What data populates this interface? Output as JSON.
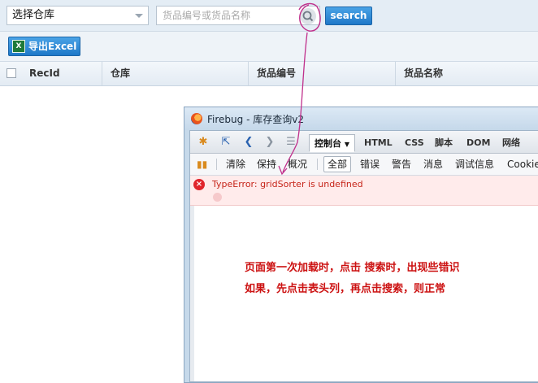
{
  "filters": {
    "warehouse_select_value": "选择仓库",
    "search_placeholder": "货品编号或货品名称",
    "search_button_label": "search"
  },
  "toolbar": {
    "export_button_label": "导出Excel",
    "export_icon": "excel-icon"
  },
  "grid": {
    "columns": [
      "RecId",
      "仓库",
      "货品编号",
      "货品名称"
    ]
  },
  "firebug": {
    "window_title": "Firebug - 库存查询v2",
    "tabs": [
      {
        "label": "控制台",
        "active": true
      },
      {
        "label": "HTML"
      },
      {
        "label": "CSS"
      },
      {
        "label": "脚本"
      },
      {
        "label": "DOM"
      },
      {
        "label": "网络"
      }
    ],
    "console_actions": [
      "清除",
      "保持",
      "概况"
    ],
    "filter_buttons": [
      {
        "label": "全部",
        "selected": true
      },
      {
        "label": "错误"
      },
      {
        "label": "警告"
      },
      {
        "label": "消息"
      },
      {
        "label": "调试信息"
      },
      {
        "label": "Cookie"
      }
    ],
    "error_message": "TypeError: gridSorter is undefined"
  },
  "annotation": {
    "line1": "页面第一次加载时，点击 搜索时，出现些错识",
    "line2": "如果，先点击表头列，再点击搜索，则正常",
    "color": "#cc1111",
    "marker_color": "#c0308c"
  }
}
